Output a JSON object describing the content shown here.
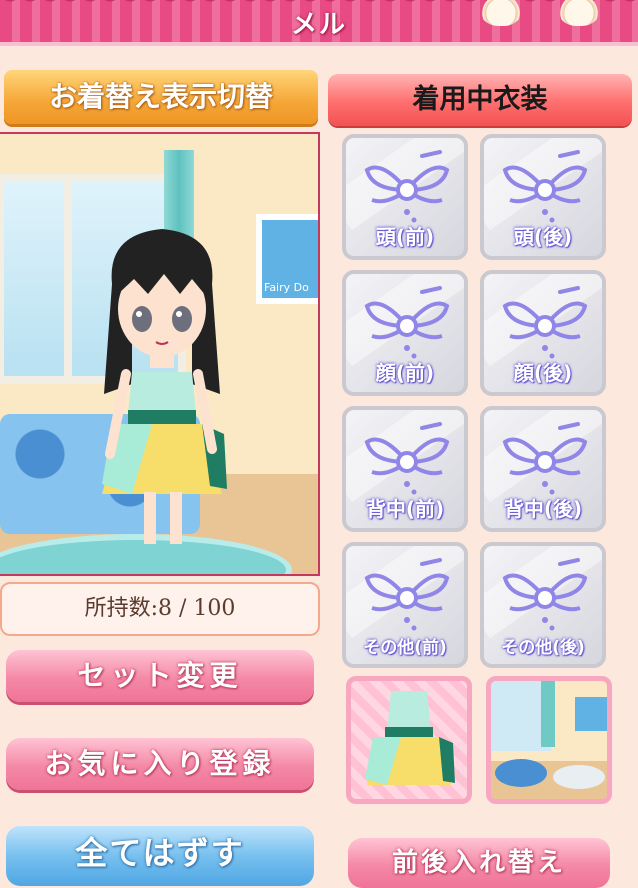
{
  "header": {
    "title": "メル"
  },
  "toggle_button": "お着替え表示切替",
  "equipped": {
    "title": "着用中衣装",
    "slots": [
      "頭(前)",
      "頭(後)",
      "顔(前)",
      "顔(後)",
      "背中(前)",
      "背中(後)",
      "その他(前)",
      "その他(後)"
    ]
  },
  "preview": {
    "poster_text": "Fairy Do"
  },
  "owned_count": "所持数:8 / 100",
  "buttons": {
    "set_change": "セット変更",
    "favorite": "お気に入り登録",
    "remove_all": "全てはずす",
    "swap_front_back": "前後入れ替え"
  },
  "icons": [
    "fairy-placeholder-icon",
    "camera-icon",
    "expand-arrows-icon"
  ],
  "colors": {
    "accent_pink": "#ef7498",
    "accent_orange": "#f5a637",
    "accent_red": "#ff6e6e",
    "accent_blue": "#4fa6e3"
  }
}
